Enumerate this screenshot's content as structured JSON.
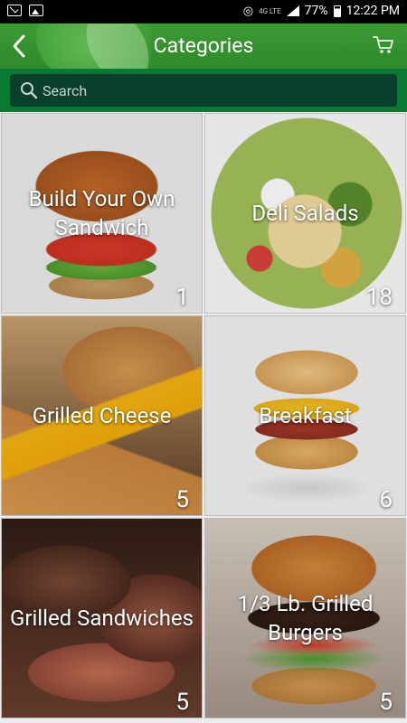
{
  "status_bar": {
    "network": "4G LTE",
    "battery": "77%",
    "time": "12:22 PM",
    "icons": [
      "mail-icon",
      "image-icon",
      "wifi-icon",
      "signal-icon",
      "battery-icon"
    ]
  },
  "header": {
    "title": "Categories",
    "back_icon": "chevron-left-icon",
    "cart_icon": "cart-icon",
    "accent_color": "#2f8a2b"
  },
  "search": {
    "placeholder": "Search",
    "icon": "search-icon"
  },
  "categories": [
    {
      "name": "Build Your Own Sandwich",
      "count": "1"
    },
    {
      "name": "Deli Salads",
      "count": "18"
    },
    {
      "name": "Grilled Cheese",
      "count": "5"
    },
    {
      "name": "Breakfast",
      "count": "6"
    },
    {
      "name": "Grilled Sandwiches",
      "count": "5"
    },
    {
      "name": "1/3 Lb. Grilled Burgers",
      "count": "5"
    }
  ]
}
